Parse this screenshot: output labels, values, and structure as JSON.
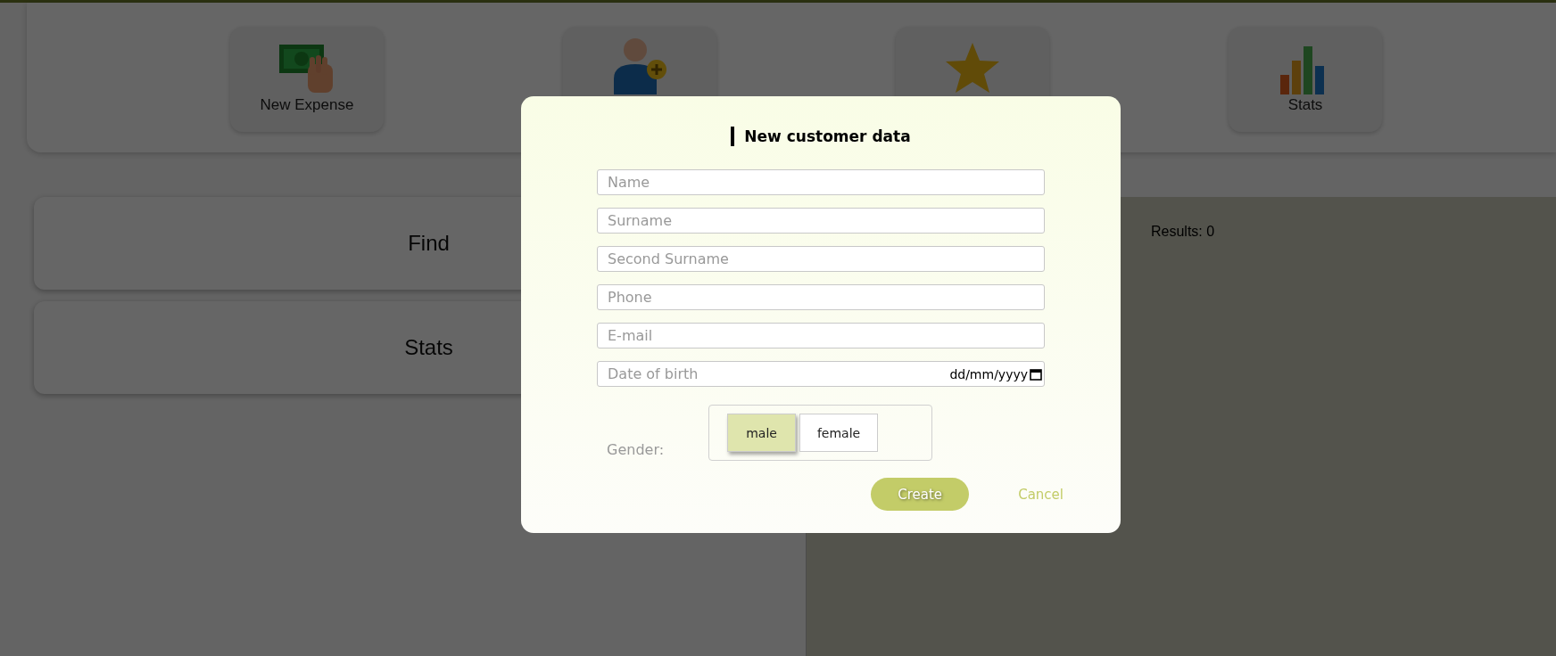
{
  "nav": {
    "tiles": [
      {
        "kind": "labelled",
        "label": "New Expense"
      },
      {
        "kind": "icon"
      },
      {
        "kind": "icon"
      },
      {
        "kind": "labelled",
        "label": "Stats"
      }
    ]
  },
  "sidebar": {
    "items": [
      "Find",
      "Stats"
    ]
  },
  "results": {
    "text": "Results: 0"
  },
  "dialog": {
    "title": "New customer data",
    "fields": [
      {
        "kind": "text",
        "placeholder": "Name"
      },
      {
        "kind": "text",
        "placeholder": "Surname"
      },
      {
        "kind": "text",
        "placeholder": "Second Surname"
      },
      {
        "kind": "text",
        "placeholder": "Phone"
      },
      {
        "kind": "text",
        "placeholder": "E-mail"
      },
      {
        "kind": "date",
        "placeholder": "Date of birth",
        "format": "dd/mm/yyyy"
      }
    ],
    "gender": {
      "label": "Gender:",
      "options": [
        {
          "label": "male",
          "selected": true
        },
        {
          "label": "female",
          "selected": false
        }
      ]
    },
    "buttons": [
      {
        "kind": "primary",
        "label": "Create"
      },
      {
        "kind": "link",
        "label": "Cancel"
      }
    ]
  }
}
